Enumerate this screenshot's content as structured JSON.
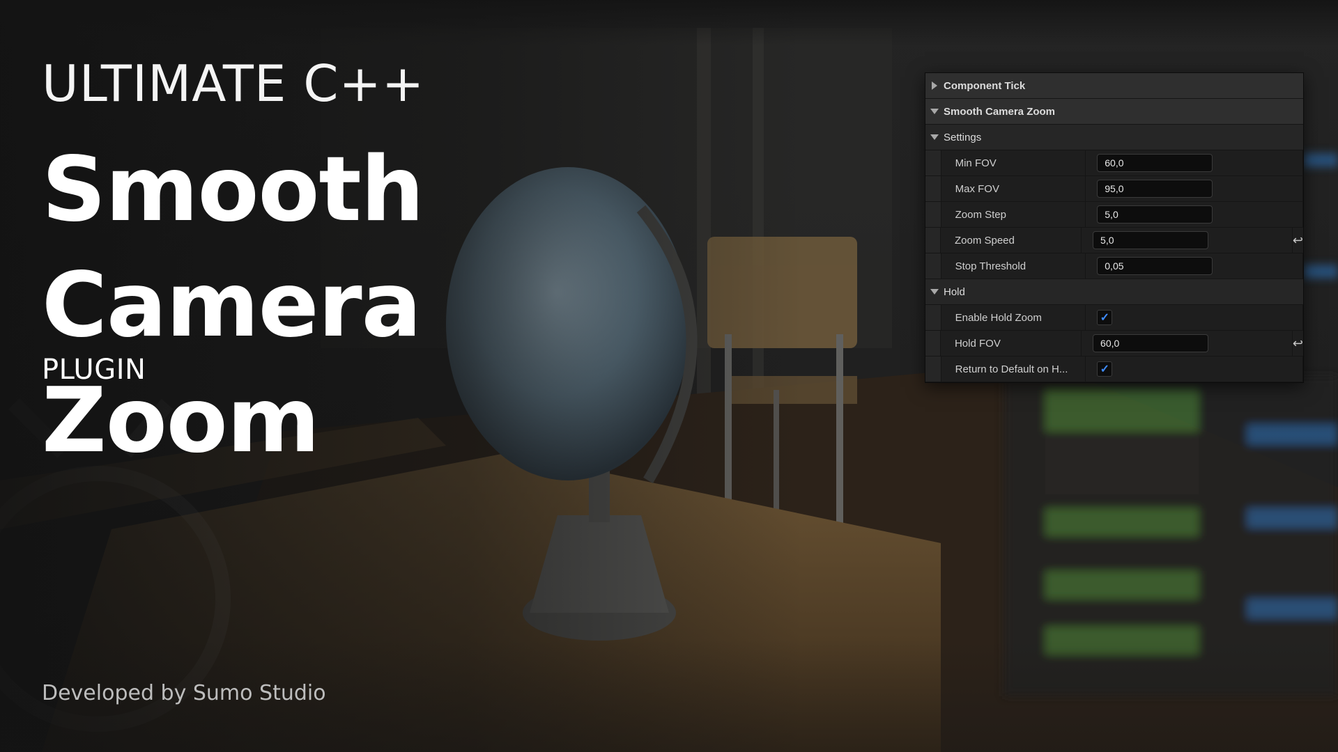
{
  "hero": {
    "eyebrow": "ULTIMATE C++",
    "title_line1": "Smooth Camera",
    "title_line2": "Zoom",
    "subtitle": "PLUGIN",
    "credit": "Developed by Sumo Studio"
  },
  "details_panel": {
    "component_tick": "Component Tick",
    "smooth_camera_zoom": "Smooth Camera Zoom",
    "settings": {
      "label": "Settings",
      "rows": [
        {
          "label": "Min FOV",
          "value": "60,0"
        },
        {
          "label": "Max FOV",
          "value": "95,0"
        },
        {
          "label": "Zoom Step",
          "value": "5,0"
        },
        {
          "label": "Zoom Speed",
          "value": "5,0",
          "has_reset": true
        },
        {
          "label": "Stop Threshold",
          "value": "0,05"
        }
      ]
    },
    "hold": {
      "label": "Hold",
      "enable_hold_zoom": {
        "label": "Enable Hold Zoom",
        "checked": true
      },
      "hold_fov": {
        "label": "Hold FOV",
        "value": "60,0",
        "has_reset": true
      },
      "return_to_default": {
        "label": "Return to Default on H...",
        "checked": true
      }
    },
    "icons": {
      "expanded": "triangle-down",
      "collapsed": "triangle-right",
      "reset": "reset-arrow-icon",
      "check": "checkmark-icon"
    },
    "colors": {
      "check": "#3f8cff"
    }
  }
}
